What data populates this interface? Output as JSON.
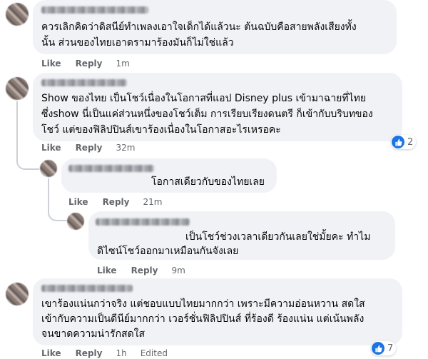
{
  "comments": [
    {
      "lines": [
        "ควรเลิกคิดว่าดิสนีย์ทำเพลงเอาใจเด็กได้แล้วนะ ต้นฉบับคือสายพลังเสียงทั้ง",
        "นั้น ส่วนของไทยเอาดรามาร้องมันก็ไม่ใช่แล้ว"
      ],
      "like": "Like",
      "reply": "Reply",
      "time": "1m"
    },
    {
      "lines": [
        "Show ของไทย เป็นโชว์เนื่องในโอกาสที่แอป Disney plus เข้ามาฉายที่ไทย",
        "ซึ่งshow นี่เป็นแค่ส่วนหนึ่งของโชว์เต็ม การเรียบเรียงดนตรี ก็เข้ากับบริบทของ",
        "โชว์ แต่ของฟิลิปปินส์เขาร้องเนื่องในโอกาสอะไรเหรอคะ"
      ],
      "like": "Like",
      "reply": "Reply",
      "time": "32m",
      "reactions": "2"
    },
    {
      "lines": [
        "โอกาสเดียวกับของไทยเลย"
      ],
      "like": "Like",
      "reply": "Reply",
      "time": "21m"
    },
    {
      "lines": [
        "เป็นโชว์ช่วงเวลาเดียวกันเลยใช่มั้ยคะ ทำไม",
        "ดิไซน์โชว์ออกมาเหมือนกันจังเลย"
      ],
      "like": "Like",
      "reply": "Reply",
      "time": "9m"
    },
    {
      "lines": [
        "เขาร้องแน่นกว่าจริง แต่ชอบแบบไทยมากกว่า เพราะมีความอ่อนหวาน สดใส",
        "เข้ากับความเป็นดีนีย์มากกว่า เวอร์ชั่นฟิลิปปินส์ ที่ร้องดี ร้องแน่น แต่เน้นพลัง",
        "จนขาดความน่ารักสดใส"
      ],
      "like": "Like",
      "reply": "Reply",
      "time": "1h",
      "edited": "Edited",
      "reactions": "7"
    }
  ],
  "colors": {
    "bubble": "#f0f2f5",
    "meta": "#65676b",
    "like_blue": "#1b74e4"
  },
  "icons": {
    "reaction": "like-icon"
  }
}
